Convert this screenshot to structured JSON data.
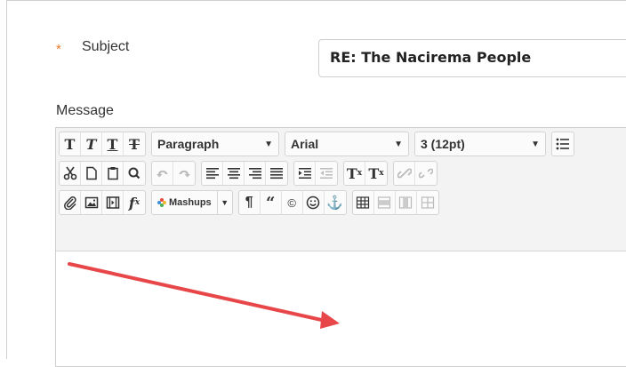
{
  "form": {
    "required_marker": "*",
    "subject_label": "Subject",
    "subject_value": "RE: The Nacirema People",
    "message_label": "Message"
  },
  "toolbar": {
    "row1": {
      "bold_glyph": "T",
      "italic_glyph": "T",
      "underline_glyph": "T",
      "strike_glyph": "T",
      "paragraph_select": "Paragraph",
      "font_select": "Arial",
      "size_select": "3 (12pt)"
    },
    "row2": {
      "superscript_glyph": "T",
      "superscript_mark": "x",
      "subscript_glyph": "T",
      "subscript_mark": "x"
    },
    "row3": {
      "formula_glyph": "f",
      "formula_mark": "x",
      "mashups_label": "Mashups",
      "paragraph_mark": "¶",
      "quote_mark": "“",
      "copyright_mark": "©",
      "anchor_mark": "⚓"
    }
  },
  "colors": {
    "required": "#e37b2a",
    "arrow": "#e8474a",
    "toolbar_bg": "#f3f3f3",
    "border": "#cfcfcf"
  }
}
